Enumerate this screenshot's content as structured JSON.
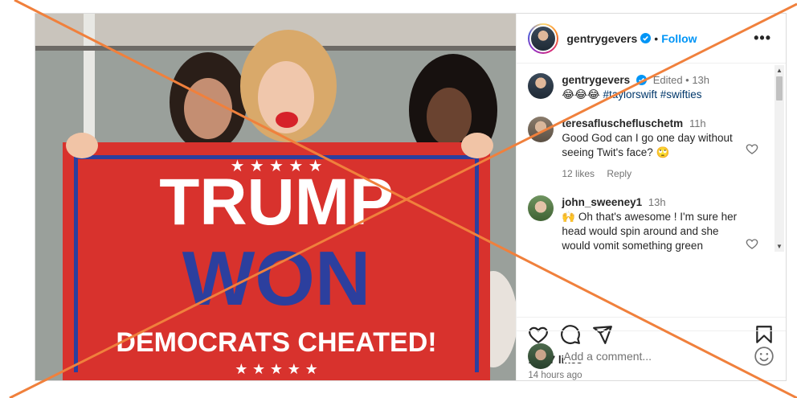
{
  "post": {
    "author": "gentrygevers",
    "follow_label": "Follow",
    "more_label": "•••",
    "caption": {
      "username": "gentrygevers",
      "meta": "Edited • 13h",
      "emojis": "😂😂😂",
      "hashtags": "#taylorswift #swifties"
    },
    "comments": [
      {
        "username": "teresafluschefluschetm",
        "time": "11h",
        "text": "Good God can I go one day without seeing Twit's face? 🙄",
        "likes": "12 likes",
        "reply_label": "Reply"
      },
      {
        "username": "john_sweeney1",
        "time": "13h",
        "text": "🙌 Oh that's awesome ! I'm sure her head would spin around and she would vomit something green"
      }
    ],
    "likes_count": "1,777 likes",
    "posted_ago": "14 hours ago",
    "add_comment_placeholder": "Add a comment..."
  },
  "media": {
    "flag_line1": "TRUMP",
    "flag_line2": "WON",
    "flag_line3": "DEMOCRATS CHEATED!"
  },
  "colors": {
    "accent": "#0095f6",
    "cross": "#f0803c",
    "flag_red": "#d8322d",
    "flag_blue": "#2c3f9e"
  },
  "icons": [
    "verified-icon",
    "more-icon",
    "heart-icon",
    "comment-icon",
    "share-icon",
    "bookmark-icon",
    "emoji-icon"
  ]
}
